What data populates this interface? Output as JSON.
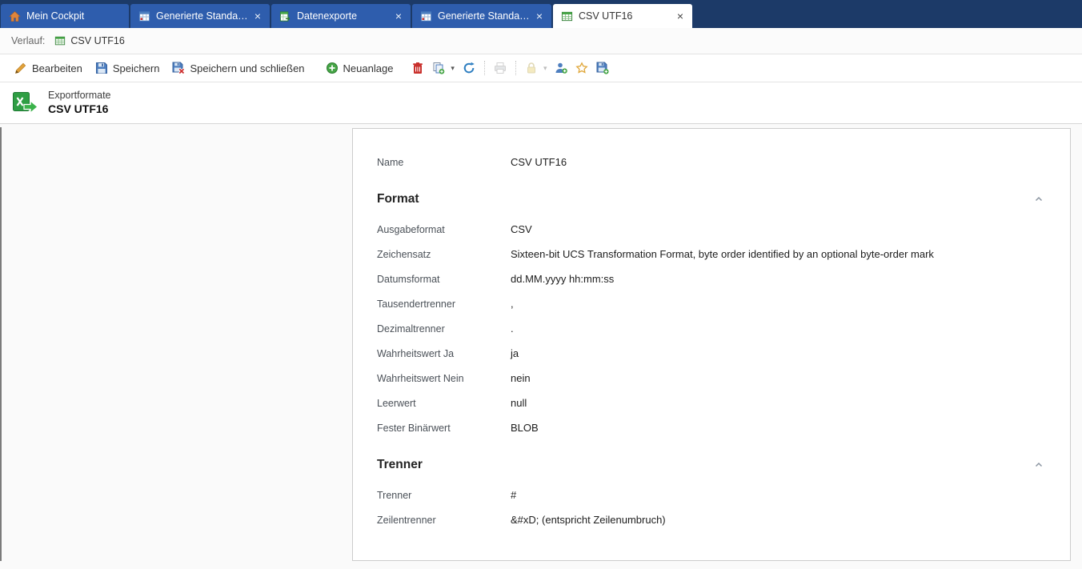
{
  "ui": {
    "close_glyph": "×",
    "caret_glyph": "▾"
  },
  "tabs": [
    {
      "label": "Mein Cockpit",
      "active": false,
      "closable": false
    },
    {
      "label": "Generierte Standar...",
      "active": false,
      "closable": true
    },
    {
      "label": "Datenexporte",
      "active": false,
      "closable": true
    },
    {
      "label": "Generierte Standar...",
      "active": false,
      "closable": true
    },
    {
      "label": "CSV UTF16",
      "active": true,
      "closable": true
    }
  ],
  "history": {
    "label": "Verlauf:",
    "items": [
      {
        "label": "CSV UTF16"
      }
    ]
  },
  "toolbar": {
    "edit_label": "Bearbeiten",
    "save_label": "Speichern",
    "save_close_label": "Speichern und schließen",
    "new_label": "Neuanlage"
  },
  "header": {
    "category": "Exportformate",
    "title": "CSV UTF16"
  },
  "form": {
    "name_row": {
      "label": "Name",
      "value": "CSV UTF16"
    },
    "sections": [
      {
        "title": "Format",
        "fields": [
          {
            "label": "Ausgabeformat",
            "value": "CSV"
          },
          {
            "label": "Zeichensatz",
            "value": "Sixteen-bit UCS Transformation Format, byte order identified by an optional byte-order mark"
          },
          {
            "label": "Datumsformat",
            "value": "dd.MM.yyyy hh:mm:ss"
          },
          {
            "label": "Tausendertrenner",
            "value": ","
          },
          {
            "label": "Dezimaltrenner",
            "value": "."
          },
          {
            "label": "Wahrheitswert Ja",
            "value": "ja"
          },
          {
            "label": "Wahrheitswert Nein",
            "value": "nein"
          },
          {
            "label": "Leerwert",
            "value": "null"
          },
          {
            "label": "Fester Binärwert",
            "value": "BLOB"
          }
        ]
      },
      {
        "title": "Trenner",
        "fields": [
          {
            "label": "Trenner",
            "value": "#"
          },
          {
            "label": "Zeilentrenner",
            "value": "&#xD; (entspricht Zeilenumbruch)"
          }
        ]
      }
    ]
  },
  "colors": {
    "tabbar_bg": "#1c3a68",
    "tab_inactive": "#2e5dad",
    "accent_green": "#2f9e44",
    "accent_blue": "#4d7ebf",
    "danger_red": "#c9302c"
  }
}
